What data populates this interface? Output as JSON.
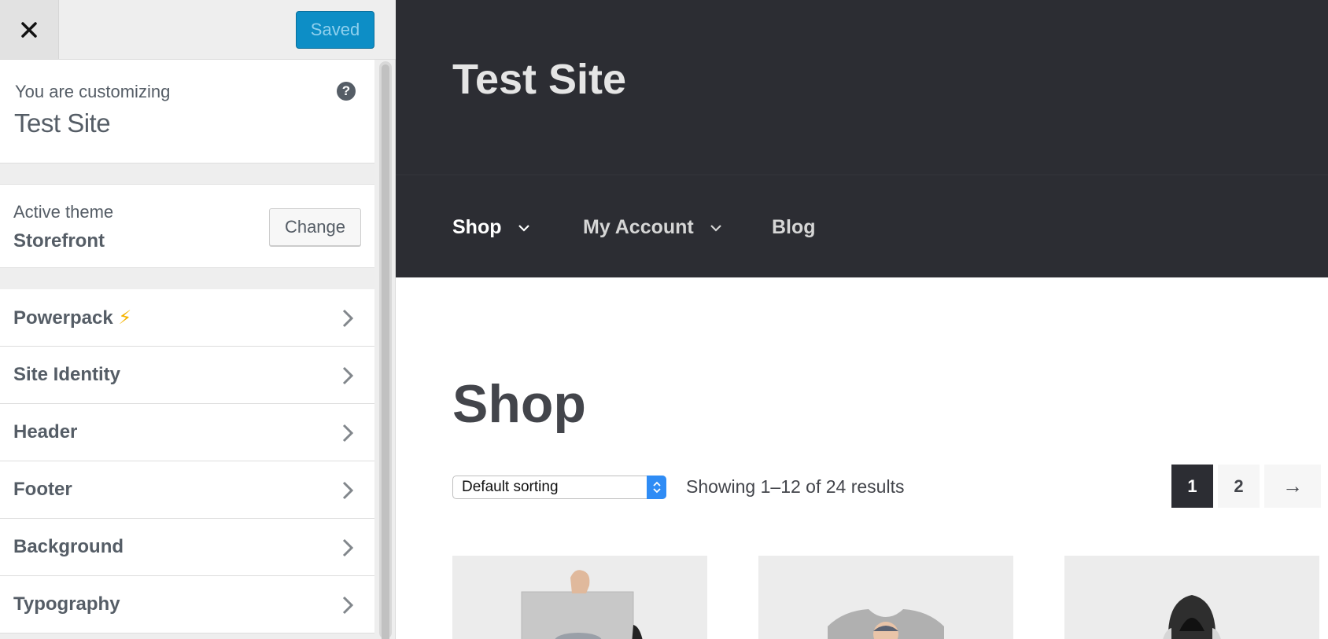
{
  "customizer": {
    "close_label": "Close",
    "save_label": "Saved",
    "info": {
      "label": "You are customizing",
      "site": "Test Site",
      "help_icon": "?"
    },
    "theme": {
      "label": "Active theme",
      "name": "Storefront",
      "change_label": "Change"
    },
    "sections": [
      {
        "label": "Powerpack",
        "badge": "⚡"
      },
      {
        "label": "Site Identity"
      },
      {
        "label": "Header"
      },
      {
        "label": "Footer"
      },
      {
        "label": "Background"
      },
      {
        "label": "Typography"
      }
    ]
  },
  "preview": {
    "site_title": "Test Site",
    "nav": [
      {
        "label": "Shop",
        "has_submenu": true
      },
      {
        "label": "My Account",
        "has_submenu": true
      },
      {
        "label": "Blog",
        "has_submenu": false
      }
    ],
    "page_title": "Shop",
    "sorting": {
      "selected": "Default sorting"
    },
    "results_text": "Showing 1–12 of 24 results",
    "pagination": {
      "pages": [
        "1",
        "2"
      ],
      "current": "1",
      "next": "→"
    }
  },
  "colors": {
    "accent": "#0d8ec6",
    "header_bg": "#2c2d33",
    "text": "#555d66"
  }
}
